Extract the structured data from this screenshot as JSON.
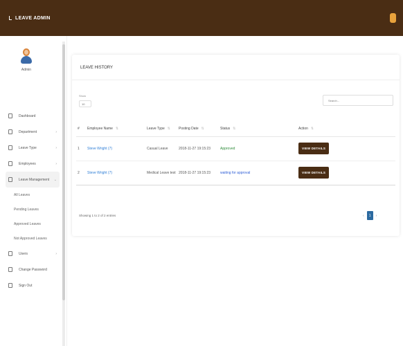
{
  "app": {
    "brand": "LEAVE ADMIN"
  },
  "profile": {
    "name": "Admin"
  },
  "sidebar": {
    "items": [
      {
        "label": "Dashboard",
        "chevron": ""
      },
      {
        "label": "Department",
        "chevron": "›"
      },
      {
        "label": "Leave Type",
        "chevron": "›"
      },
      {
        "label": "Employees",
        "chevron": "›"
      },
      {
        "label": "Leave Management",
        "chevron": "⌄"
      }
    ],
    "sub_items": [
      "All Leaves",
      "Pending Leaves",
      "Approved Leaves",
      "Not Approved Leaves"
    ],
    "items_after": [
      {
        "label": "Users",
        "chevron": "›"
      },
      {
        "label": "Change Password",
        "chevron": ""
      },
      {
        "label": "Sign Out",
        "chevron": ""
      }
    ]
  },
  "card": {
    "title": "LEAVE HISTORY",
    "show_label": "Show",
    "page_size": "10",
    "search_placeholder": "Search..."
  },
  "table": {
    "headers": [
      "#",
      "Employee Name",
      "Leave Type",
      "Posting Date",
      "Status",
      "Action"
    ],
    "rows": [
      {
        "num": "1",
        "name": "Steve Wright (7)",
        "type": "Casual Leave",
        "date": "2018-11-27 19:15:23",
        "status": "Approved",
        "status_kind": "approved",
        "action": "VIEW DETAILS"
      },
      {
        "num": "2",
        "name": "Steve Wright (7)",
        "type": "Medical Leave test",
        "date": "2018-11-27 19:15:23",
        "status": "waiting for approval",
        "status_kind": "pending",
        "action": "VIEW DETAILS"
      }
    ]
  },
  "footer": {
    "info": "Showing 1 to 2 of 2 entries",
    "prev": "‹",
    "page": "1",
    "next": "›"
  },
  "colors": {
    "brand": "#4a2d14",
    "link": "#2e7ed6",
    "approved": "#2e8b3a",
    "pending": "#2e5ed6",
    "pager": "#2c6aa0"
  }
}
